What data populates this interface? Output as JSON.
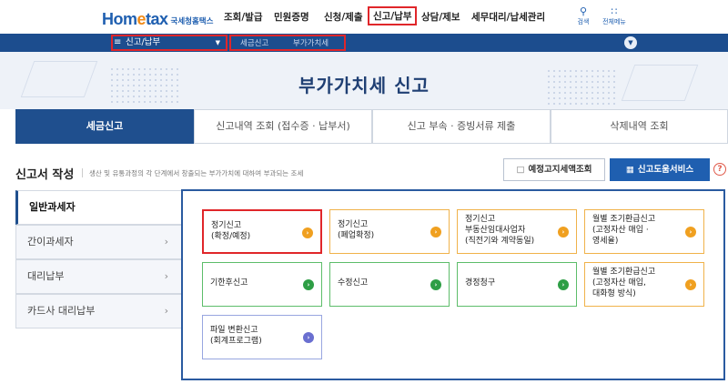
{
  "header": {
    "logo_main_prefix": "Hom",
    "logo_main_e": "e",
    "logo_main_suffix": "tax",
    "logo_sub": "국세청홈택스",
    "logo_tiny": "",
    "menu": [
      {
        "label": "조회/발급"
      },
      {
        "label": "민원증명"
      },
      {
        "label": "신청/제출"
      },
      {
        "label": "신고/납부",
        "highlighted": true
      },
      {
        "label": "상담/제보"
      },
      {
        "label": "세무대리/납세관리"
      }
    ],
    "icons": [
      {
        "label": "검색",
        "icon": "search-icon"
      },
      {
        "label": "전체메뉴",
        "icon": "grid-menu-icon"
      }
    ]
  },
  "navbar": {
    "selected": "신고/납부",
    "breadcrumbs": [
      "세금신고",
      "부가가치세"
    ]
  },
  "page": {
    "title": "부가가치세 신고"
  },
  "tabs": [
    {
      "label": "세금신고",
      "active": true
    },
    {
      "label": "신고내역 조회 (접수증 · 납부서)"
    },
    {
      "label": "신고 부속 · 증빙서류 제출"
    },
    {
      "label": "삭제내역 조회"
    }
  ],
  "section": {
    "title": "신고서 작성",
    "description": "생산 및 유통과정의 각 단계에서 창출되는 부가가치에 대하여 부과되는 조세",
    "btn_notice": "예정고지세액조회",
    "btn_help_service": "신고도움서비스",
    "help_label": "?"
  },
  "side_menu": [
    {
      "label": "일반과세자",
      "active": true
    },
    {
      "label": "간이과세자"
    },
    {
      "label": "대리납부"
    },
    {
      "label": "카드사 대리납부"
    }
  ],
  "side_arrow": "›",
  "cards": [
    {
      "lines": [
        "정기신고",
        "(확정/예정)"
      ],
      "color": "orange",
      "highlighted": true
    },
    {
      "lines": [
        "정기신고",
        "(폐업확정)"
      ],
      "color": "orange"
    },
    {
      "lines": [
        "정기신고",
        "부동산임대사업자",
        "(직전기와 계약동일)"
      ],
      "color": "orange"
    },
    {
      "lines": [
        "월별 조기환급신고",
        "(고정자산 매입 ·",
        "영세율)"
      ],
      "color": "orange"
    },
    {
      "lines": [
        "기한후신고"
      ],
      "color": "green"
    },
    {
      "lines": [
        "수정신고"
      ],
      "color": "green"
    },
    {
      "lines": [
        "경정청구"
      ],
      "color": "green"
    },
    {
      "lines": [
        "월별 조기환급신고",
        "(고정자산 매입,",
        "대화형 방식)"
      ],
      "color": "orange"
    },
    {
      "lines": [
        "파일 변환신고",
        "(회계프로그램)"
      ],
      "color": "blue"
    }
  ],
  "colors": {
    "primary": "#1f4f8e",
    "navbar": "#1c4d8e",
    "highlight": "#e0262a",
    "orange": "#f0a020",
    "green": "#2e9e45",
    "blue": "#6a6fd0"
  }
}
